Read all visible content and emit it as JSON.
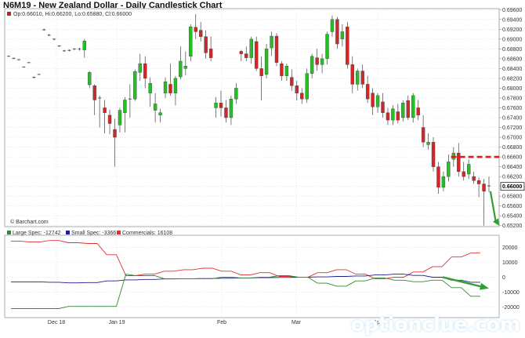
{
  "chart_data": {
    "type": "candlestick",
    "title": "N6M19 - New Zealand Dollar - Daily Candlestick Chart",
    "ohlc_legend": "Op:0.66010, Hi:0.66200, Lo:0.65880, Cl:0.66000",
    "source": "© Barchart.com",
    "price_axis": {
      "ylim": [
        0.6518,
        0.6962
      ],
      "ticks": [
        "0.69600",
        "0.69400",
        "0.69200",
        "0.69000",
        "0.68800",
        "0.68600",
        "0.68400",
        "0.68200",
        "0.68000",
        "0.67800",
        "0.67600",
        "0.67400",
        "0.67200",
        "0.67000",
        "0.66800",
        "0.66600",
        "0.66400",
        "0.66200",
        "0.66000",
        "0.65800",
        "0.65600",
        "0.65400",
        "0.65200"
      ],
      "last_price": "0.66000",
      "resistance": 0.666
    },
    "candles": [
      {
        "o": 0.6865,
        "h": 0.6866,
        "l": 0.6864,
        "c": 0.6865
      },
      {
        "o": 0.686,
        "h": 0.6862,
        "l": 0.6859,
        "c": 0.6861
      },
      {
        "o": 0.6858,
        "h": 0.6859,
        "l": 0.6857,
        "c": 0.6858
      },
      {
        "o": 0.6843,
        "h": 0.6844,
        "l": 0.6842,
        "c": 0.6843
      },
      {
        "o": 0.6852,
        "h": 0.6853,
        "l": 0.6851,
        "c": 0.6852
      },
      {
        "o": 0.6822,
        "h": 0.6824,
        "l": 0.682,
        "c": 0.6822
      },
      {
        "o": 0.6828,
        "h": 0.6829,
        "l": 0.6827,
        "c": 0.6828
      },
      {
        "o": 0.6918,
        "h": 0.6921,
        "l": 0.6917,
        "c": 0.6919
      },
      {
        "o": 0.6908,
        "h": 0.691,
        "l": 0.6906,
        "c": 0.6908
      },
      {
        "o": 0.6898,
        "h": 0.6901,
        "l": 0.6897,
        "c": 0.69
      },
      {
        "o": 0.6885,
        "h": 0.6887,
        "l": 0.6884,
        "c": 0.6886
      },
      {
        "o": 0.6876,
        "h": 0.6878,
        "l": 0.6874,
        "c": 0.6876
      },
      {
        "o": 0.6877,
        "h": 0.6879,
        "l": 0.6875,
        "c": 0.6877
      },
      {
        "o": 0.688,
        "h": 0.6881,
        "l": 0.6877,
        "c": 0.6878
      },
      {
        "o": 0.688,
        "h": 0.6882,
        "l": 0.6876,
        "c": 0.6879
      },
      {
        "o": 0.6878,
        "h": 0.69,
        "l": 0.6862,
        "c": 0.6896
      },
      {
        "o": 0.6807,
        "h": 0.6835,
        "l": 0.68,
        "c": 0.6832
      },
      {
        "o": 0.6805,
        "h": 0.6808,
        "l": 0.6745,
        "c": 0.6776
      },
      {
        "o": 0.6778,
        "h": 0.6785,
        "l": 0.672,
        "c": 0.678
      },
      {
        "o": 0.676,
        "h": 0.6776,
        "l": 0.6708,
        "c": 0.675
      },
      {
        "o": 0.6745,
        "h": 0.6756,
        "l": 0.6706,
        "c": 0.6728
      },
      {
        "o": 0.6716,
        "h": 0.6738,
        "l": 0.664,
        "c": 0.67
      },
      {
        "o": 0.6725,
        "h": 0.676,
        "l": 0.671,
        "c": 0.6755
      },
      {
        "o": 0.675,
        "h": 0.6782,
        "l": 0.671,
        "c": 0.6776
      },
      {
        "o": 0.6776,
        "h": 0.6808,
        "l": 0.674,
        "c": 0.6778
      },
      {
        "o": 0.6778,
        "h": 0.6838,
        "l": 0.6774,
        "c": 0.6834
      },
      {
        "o": 0.6832,
        "h": 0.687,
        "l": 0.6815,
        "c": 0.685
      },
      {
        "o": 0.685,
        "h": 0.6865,
        "l": 0.68,
        "c": 0.682
      },
      {
        "o": 0.679,
        "h": 0.6822,
        "l": 0.6762,
        "c": 0.681
      },
      {
        "o": 0.6755,
        "h": 0.679,
        "l": 0.673,
        "c": 0.6768
      },
      {
        "o": 0.6745,
        "h": 0.6758,
        "l": 0.673,
        "c": 0.675
      },
      {
        "o": 0.679,
        "h": 0.6822,
        "l": 0.678,
        "c": 0.6813
      },
      {
        "o": 0.6808,
        "h": 0.685,
        "l": 0.6785,
        "c": 0.679
      },
      {
        "o": 0.679,
        "h": 0.6825,
        "l": 0.6765,
        "c": 0.682
      },
      {
        "o": 0.6823,
        "h": 0.6885,
        "l": 0.6818,
        "c": 0.6855
      },
      {
        "o": 0.684,
        "h": 0.6875,
        "l": 0.6826,
        "c": 0.6845
      },
      {
        "o": 0.6865,
        "h": 0.693,
        "l": 0.6855,
        "c": 0.6925
      },
      {
        "o": 0.6924,
        "h": 0.6951,
        "l": 0.69,
        "c": 0.6915
      },
      {
        "o": 0.6918,
        "h": 0.6935,
        "l": 0.6895,
        "c": 0.6905
      },
      {
        "o": 0.6905,
        "h": 0.6918,
        "l": 0.686,
        "c": 0.6872
      },
      {
        "o": 0.688,
        "h": 0.6905,
        "l": 0.6855,
        "c": 0.6862
      },
      {
        "o": 0.676,
        "h": 0.6782,
        "l": 0.674,
        "c": 0.677
      },
      {
        "o": 0.677,
        "h": 0.6795,
        "l": 0.6742,
        "c": 0.676
      },
      {
        "o": 0.676,
        "h": 0.6776,
        "l": 0.673,
        "c": 0.674
      },
      {
        "o": 0.674,
        "h": 0.6785,
        "l": 0.6725,
        "c": 0.6778
      },
      {
        "o": 0.6778,
        "h": 0.681,
        "l": 0.6768,
        "c": 0.68
      },
      {
        "o": 0.6875,
        "h": 0.6878,
        "l": 0.6855,
        "c": 0.687
      },
      {
        "o": 0.687,
        "h": 0.6885,
        "l": 0.6855,
        "c": 0.6862
      },
      {
        "o": 0.6862,
        "h": 0.6905,
        "l": 0.685,
        "c": 0.69
      },
      {
        "o": 0.6895,
        "h": 0.6905,
        "l": 0.6835,
        "c": 0.684
      },
      {
        "o": 0.684,
        "h": 0.6865,
        "l": 0.6775,
        "c": 0.6825
      },
      {
        "o": 0.6828,
        "h": 0.689,
        "l": 0.682,
        "c": 0.688
      },
      {
        "o": 0.6882,
        "h": 0.6915,
        "l": 0.6866,
        "c": 0.6906
      },
      {
        "o": 0.6906,
        "h": 0.6912,
        "l": 0.6845,
        "c": 0.6852
      },
      {
        "o": 0.685,
        "h": 0.6855,
        "l": 0.6815,
        "c": 0.6825
      },
      {
        "o": 0.6825,
        "h": 0.685,
        "l": 0.6815,
        "c": 0.6845
      },
      {
        "o": 0.6822,
        "h": 0.6838,
        "l": 0.6795,
        "c": 0.6805
      },
      {
        "o": 0.6805,
        "h": 0.6815,
        "l": 0.6775,
        "c": 0.679
      },
      {
        "o": 0.679,
        "h": 0.68,
        "l": 0.6768,
        "c": 0.6778
      },
      {
        "o": 0.6778,
        "h": 0.684,
        "l": 0.677,
        "c": 0.683
      },
      {
        "o": 0.683,
        "h": 0.687,
        "l": 0.682,
        "c": 0.6865
      },
      {
        "o": 0.6862,
        "h": 0.688,
        "l": 0.6835,
        "c": 0.6848
      },
      {
        "o": 0.6848,
        "h": 0.687,
        "l": 0.683,
        "c": 0.686
      },
      {
        "o": 0.686,
        "h": 0.6915,
        "l": 0.6848,
        "c": 0.691
      },
      {
        "o": 0.6915,
        "h": 0.6948,
        "l": 0.6905,
        "c": 0.694
      },
      {
        "o": 0.694,
        "h": 0.6945,
        "l": 0.688,
        "c": 0.689
      },
      {
        "o": 0.69,
        "h": 0.693,
        "l": 0.6885,
        "c": 0.6915
      },
      {
        "o": 0.6925,
        "h": 0.6935,
        "l": 0.684,
        "c": 0.6848
      },
      {
        "o": 0.6848,
        "h": 0.6865,
        "l": 0.679,
        "c": 0.6808
      },
      {
        "o": 0.6808,
        "h": 0.684,
        "l": 0.6795,
        "c": 0.6835
      },
      {
        "o": 0.6835,
        "h": 0.6848,
        "l": 0.68,
        "c": 0.6808
      },
      {
        "o": 0.6808,
        "h": 0.6825,
        "l": 0.677,
        "c": 0.6778
      },
      {
        "o": 0.679,
        "h": 0.68,
        "l": 0.6745,
        "c": 0.6762
      },
      {
        "o": 0.6762,
        "h": 0.679,
        "l": 0.675,
        "c": 0.6785
      },
      {
        "o": 0.6772,
        "h": 0.679,
        "l": 0.674,
        "c": 0.675
      },
      {
        "o": 0.675,
        "h": 0.676,
        "l": 0.6725,
        "c": 0.6735
      },
      {
        "o": 0.6735,
        "h": 0.6765,
        "l": 0.6725,
        "c": 0.6758
      },
      {
        "o": 0.6752,
        "h": 0.6768,
        "l": 0.6728,
        "c": 0.6735
      },
      {
        "o": 0.674,
        "h": 0.6775,
        "l": 0.6732,
        "c": 0.677
      },
      {
        "o": 0.6775,
        "h": 0.6785,
        "l": 0.6735,
        "c": 0.674
      },
      {
        "o": 0.674,
        "h": 0.679,
        "l": 0.673,
        "c": 0.6785
      },
      {
        "o": 0.676,
        "h": 0.6776,
        "l": 0.6735,
        "c": 0.6745
      },
      {
        "o": 0.672,
        "h": 0.6745,
        "l": 0.668,
        "c": 0.669
      },
      {
        "o": 0.6685,
        "h": 0.6708,
        "l": 0.6675,
        "c": 0.669
      },
      {
        "o": 0.669,
        "h": 0.67,
        "l": 0.663,
        "c": 0.664
      },
      {
        "o": 0.664,
        "h": 0.665,
        "l": 0.6585,
        "c": 0.6598
      },
      {
        "o": 0.6598,
        "h": 0.663,
        "l": 0.659,
        "c": 0.662
      },
      {
        "o": 0.662,
        "h": 0.6665,
        "l": 0.661,
        "c": 0.665
      },
      {
        "o": 0.6655,
        "h": 0.668,
        "l": 0.664,
        "c": 0.6668
      },
      {
        "o": 0.6668,
        "h": 0.6688,
        "l": 0.662,
        "c": 0.663
      },
      {
        "o": 0.663,
        "h": 0.665,
        "l": 0.6612,
        "c": 0.662
      },
      {
        "o": 0.6625,
        "h": 0.6655,
        "l": 0.6615,
        "c": 0.6645
      },
      {
        "o": 0.662,
        "h": 0.663,
        "l": 0.6605,
        "c": 0.6612
      },
      {
        "o": 0.6612,
        "h": 0.6618,
        "l": 0.6578,
        "c": 0.6605
      },
      {
        "o": 0.6605,
        "h": 0.6615,
        "l": 0.652,
        "c": 0.659
      },
      {
        "o": 0.6601,
        "h": 0.662,
        "l": 0.6588,
        "c": 0.66
      }
    ],
    "x_tick_labels": [
      "Dec 18",
      "Jan 19",
      "Feb",
      "Mar",
      "Apr"
    ],
    "cot": {
      "legend": [
        {
          "name": "Large Spec: -12742",
          "color": "#2e8b2e"
        },
        {
          "name": "Small Spec: -3366",
          "color": "#1f1f8f"
        },
        {
          "name": "Commercials: 16108",
          "color": "#e03030"
        }
      ],
      "ylim": [
        -27000,
        28000
      ],
      "ticks": [
        "20000",
        "10000",
        "0",
        "-10000",
        "-20000"
      ],
      "large_spec": [
        -21000,
        -21000,
        -21000,
        -21000,
        -21000,
        -21000,
        -19500,
        -19500,
        -19500,
        -19500,
        -19500,
        -19500,
        2000,
        1000,
        1000,
        1000,
        -1000,
        -1000,
        -1000,
        -1000,
        -1000,
        -1000,
        0,
        0,
        -500,
        -500,
        0,
        0,
        1000,
        1000,
        0,
        0,
        -4000,
        -4000,
        -6000,
        -6000,
        -2500,
        -2500,
        -500,
        -500,
        -2000,
        -2000,
        -3000,
        -3000,
        -2000,
        -2000,
        -7000,
        -7000,
        -12742,
        -12742
      ],
      "small_spec": [
        -3200,
        -3200,
        -3100,
        -3100,
        -3400,
        -3400,
        -3800,
        -3800,
        -3600,
        -3600,
        -2500,
        -2500,
        -1800,
        -1800,
        -1500,
        -1500,
        -1200,
        -1200,
        -1000,
        -1000,
        -900,
        -900,
        -700,
        -700,
        -500,
        -500,
        -300,
        -300,
        -200,
        -200,
        0,
        0,
        200,
        200,
        500,
        500,
        800,
        800,
        1500,
        1500,
        2000,
        2000,
        1200,
        1200,
        0,
        0,
        -2000,
        -2000,
        -3366,
        -3366
      ],
      "commercials": [
        24000,
        24000,
        23500,
        23500,
        24500,
        24500,
        23000,
        23000,
        22500,
        22500,
        15000,
        15000,
        1000,
        1000,
        2000,
        2000,
        4000,
        4000,
        5000,
        5000,
        6000,
        6000,
        4000,
        4000,
        1500,
        1500,
        3000,
        3000,
        500,
        500,
        0,
        0,
        3000,
        3000,
        5000,
        5000,
        2000,
        2000,
        -1000,
        -1000,
        0,
        0,
        3500,
        3500,
        7000,
        7000,
        13500,
        13500,
        16108,
        16108
      ]
    },
    "colors": {
      "up": "#22c022",
      "down": "#d02828",
      "grid": "#d7d7d7",
      "axis_text": "#333333",
      "resistance": "#e31b1b",
      "annotation_arrow": "#2fa02f"
    }
  },
  "watermark": "optionclue.com"
}
